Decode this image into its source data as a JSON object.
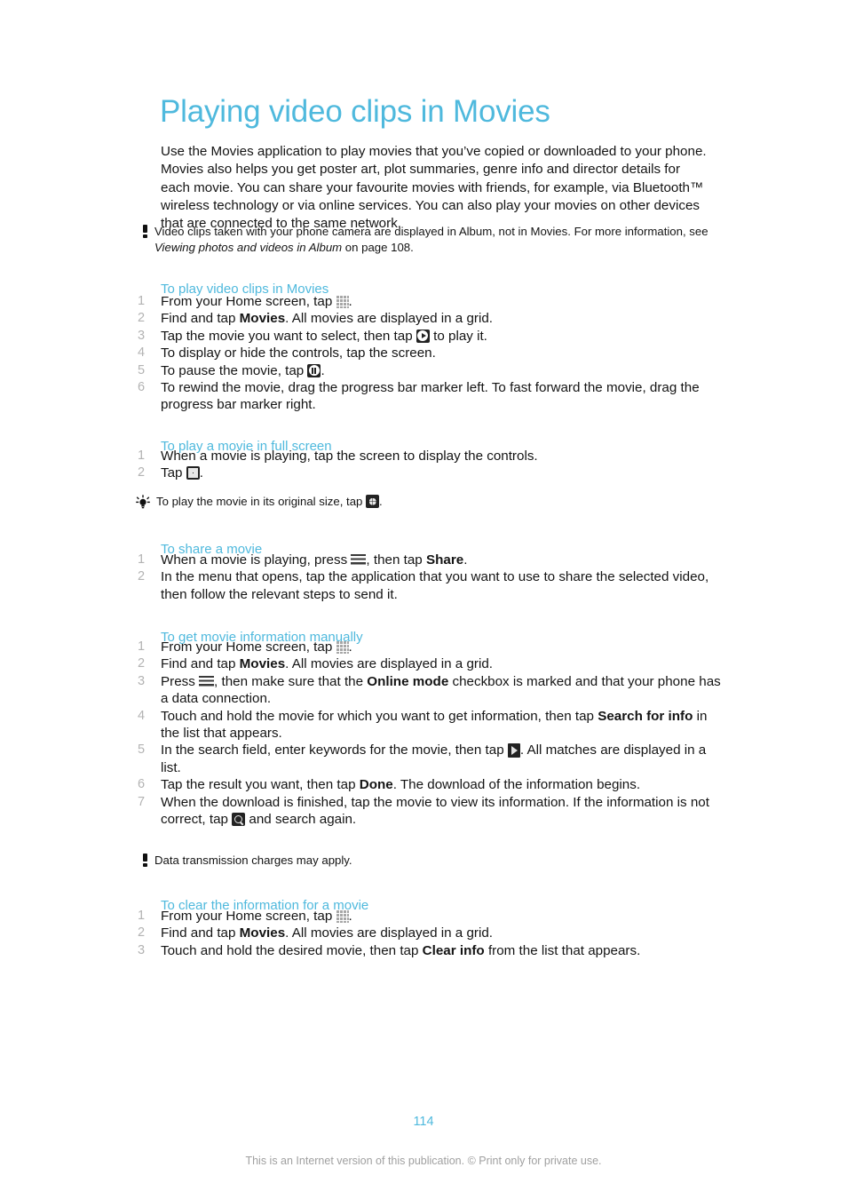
{
  "document": {
    "title": "Playing video clips in Movies",
    "intro": "Use the Movies application to play movies that you’ve copied or downloaded to your phone. Movies also helps you get poster art, plot summaries, genre info and director details for each movie. You can share your favourite movies with friends, for example, via Bluetooth™ wireless technology or via online services. You can also play your movies on other devices that are connected to the same network.",
    "page_number": "114",
    "footer": "This is an Internet version of this publication. © Print only for private use.",
    "accent_color": "#4fb9dd",
    "number_color": "#b3b3b3",
    "text_color": "#141414"
  },
  "note_top": {
    "icon": "exclamation-icon",
    "text_before": "Video clips taken with your phone camera are displayed in Album, not in Movies. For more information, see ",
    "italic": "Viewing photos and videos in Album",
    "text_after": " on page 108."
  },
  "section_play": {
    "heading": "To play video clips in Movies",
    "steps": [
      {
        "num": "1",
        "parts": [
          {
            "t": "text",
            "v": "From your Home screen, tap "
          },
          {
            "t": "icon",
            "v": "app-drawer-grid-icon"
          },
          {
            "t": "text",
            "v": "."
          }
        ]
      },
      {
        "num": "2",
        "parts": [
          {
            "t": "text",
            "v": "Find and tap "
          },
          {
            "t": "bold",
            "v": "Movies"
          },
          {
            "t": "text",
            "v": ". All movies are displayed in a grid."
          }
        ]
      },
      {
        "num": "3",
        "parts": [
          {
            "t": "text",
            "v": "Tap the movie you want to select, then tap "
          },
          {
            "t": "icon",
            "v": "play-icon"
          },
          {
            "t": "text",
            "v": " to play it."
          }
        ]
      },
      {
        "num": "4",
        "parts": [
          {
            "t": "text",
            "v": "To display or hide the controls, tap the screen."
          }
        ]
      },
      {
        "num": "5",
        "parts": [
          {
            "t": "text",
            "v": "To pause the movie, tap "
          },
          {
            "t": "icon",
            "v": "pause-icon"
          },
          {
            "t": "text",
            "v": "."
          }
        ]
      },
      {
        "num": "6",
        "parts": [
          {
            "t": "text",
            "v": "To rewind the movie, drag the progress bar marker left. To fast forward the movie, drag the progress bar marker right."
          }
        ]
      }
    ]
  },
  "section_fullscreen": {
    "heading": "To play a movie in full screen",
    "steps": [
      {
        "num": "1",
        "parts": [
          {
            "t": "text",
            "v": "When a movie is playing, tap the screen to display the controls."
          }
        ]
      },
      {
        "num": "2",
        "parts": [
          {
            "t": "text",
            "v": "Tap "
          },
          {
            "t": "icon",
            "v": "expand-fullscreen-icon"
          },
          {
            "t": "text",
            "v": "."
          }
        ]
      }
    ],
    "tip": {
      "icon": "lightbulb-icon",
      "text_before": "To play the movie in its original size, tap ",
      "icon_inline": "shrink-original-size-icon",
      "text_after": "."
    }
  },
  "section_share": {
    "heading": "To share a movie",
    "steps": [
      {
        "num": "1",
        "parts": [
          {
            "t": "text",
            "v": "When a movie is playing, press "
          },
          {
            "t": "icon",
            "v": "menu-key-icon"
          },
          {
            "t": "text",
            "v": ", then tap "
          },
          {
            "t": "bold",
            "v": "Share"
          },
          {
            "t": "text",
            "v": "."
          }
        ]
      },
      {
        "num": "2",
        "parts": [
          {
            "t": "text",
            "v": "In the menu that opens, tap the application that you want to use to share the selected video, then follow the relevant steps to send it."
          }
        ]
      }
    ]
  },
  "section_get_info": {
    "heading": "To get movie information manually",
    "steps": [
      {
        "num": "1",
        "parts": [
          {
            "t": "text",
            "v": "From your Home screen, tap "
          },
          {
            "t": "icon",
            "v": "app-drawer-grid-icon"
          },
          {
            "t": "text",
            "v": "."
          }
        ]
      },
      {
        "num": "2",
        "parts": [
          {
            "t": "text",
            "v": "Find and tap "
          },
          {
            "t": "bold",
            "v": "Movies"
          },
          {
            "t": "text",
            "v": ". All movies are displayed in a grid."
          }
        ]
      },
      {
        "num": "3",
        "parts": [
          {
            "t": "text",
            "v": "Press "
          },
          {
            "t": "icon",
            "v": "menu-key-icon"
          },
          {
            "t": "text",
            "v": ", then make sure that the "
          },
          {
            "t": "bold",
            "v": "Online mode"
          },
          {
            "t": "text",
            "v": " checkbox is marked and that your phone has a data connection."
          }
        ]
      },
      {
        "num": "4",
        "parts": [
          {
            "t": "text",
            "v": "Touch and hold the movie for which you want to get information, then tap "
          },
          {
            "t": "bold",
            "v": "Search for info"
          },
          {
            "t": "text",
            "v": " in the list that appears."
          }
        ]
      },
      {
        "num": "5",
        "parts": [
          {
            "t": "text",
            "v": "In the search field, enter keywords for the movie, then tap "
          },
          {
            "t": "icon",
            "v": "go-arrow-icon"
          },
          {
            "t": "text",
            "v": ". All matches are displayed in a list."
          }
        ]
      },
      {
        "num": "6",
        "parts": [
          {
            "t": "text",
            "v": "Tap the result you want, then tap "
          },
          {
            "t": "bold",
            "v": "Done"
          },
          {
            "t": "text",
            "v": ". The download of the information begins."
          }
        ]
      },
      {
        "num": "7",
        "parts": [
          {
            "t": "text",
            "v": "When the download is finished, tap the movie to view its information. If the information is not correct, tap "
          },
          {
            "t": "icon",
            "v": "search-magnifier-icon"
          },
          {
            "t": "text",
            "v": " and search again."
          }
        ]
      }
    ],
    "note": {
      "icon": "exclamation-icon",
      "text": "Data transmission charges may apply."
    }
  },
  "section_clear_info": {
    "heading": "To clear the information for a movie",
    "steps": [
      {
        "num": "1",
        "parts": [
          {
            "t": "text",
            "v": "From your Home screen, tap "
          },
          {
            "t": "icon",
            "v": "app-drawer-grid-icon"
          },
          {
            "t": "text",
            "v": "."
          }
        ]
      },
      {
        "num": "2",
        "parts": [
          {
            "t": "text",
            "v": "Find and tap "
          },
          {
            "t": "bold",
            "v": "Movies"
          },
          {
            "t": "text",
            "v": ". All movies are displayed in a grid."
          }
        ]
      },
      {
        "num": "3",
        "parts": [
          {
            "t": "text",
            "v": "Touch and hold the desired movie, then tap "
          },
          {
            "t": "bold",
            "v": "Clear info"
          },
          {
            "t": "text",
            "v": " from the list that appears."
          }
        ]
      }
    ]
  }
}
